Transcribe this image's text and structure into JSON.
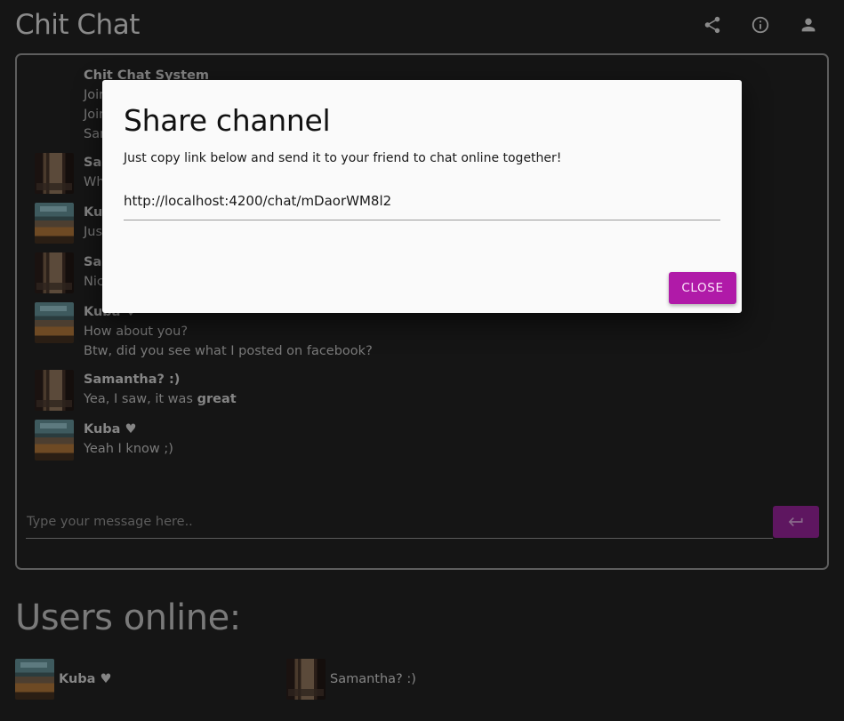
{
  "app": {
    "title": "Chit Chat"
  },
  "toolbar": {
    "icons": [
      "share-icon",
      "info-icon",
      "person-icon"
    ]
  },
  "chat": {
    "groups": [
      {
        "author": "Chit Chat System",
        "avatar": "none",
        "lines": [
          "Joined the channel",
          "Joined the channel",
          "Samantha? :) joined the channel"
        ]
      },
      {
        "author": "Samantha? :)",
        "avatar": "sam",
        "lines": [
          "What's up?"
        ]
      },
      {
        "author": "Kuba ♥",
        "avatar": "kuba",
        "lines": [
          "Just fine"
        ]
      },
      {
        "author": "Samantha? :)",
        "avatar": "sam",
        "lines": [
          "Nice"
        ]
      },
      {
        "author": "Kuba ♥",
        "avatar": "kuba",
        "lines": [
          "How about you?",
          "Btw, did you see what I posted on facebook?"
        ]
      },
      {
        "author": "Samantha? :)",
        "avatar": "sam",
        "lines": [
          "Yea, I saw, it was "
        ],
        "bold_suffix": "great"
      },
      {
        "author": "Kuba ♥",
        "avatar": "kuba",
        "lines": [
          "Yeah I know ;)"
        ]
      }
    ],
    "input": {
      "placeholder": "Type your message here..",
      "value": ""
    },
    "send_icon": "return-arrow-icon"
  },
  "users": {
    "title": "Users online:",
    "list": [
      {
        "name": "Kuba ♥",
        "avatar": "kuba",
        "bold": true
      },
      {
        "name": "Samantha? :)",
        "avatar": "sam",
        "bold": false
      }
    ]
  },
  "dialog": {
    "title": "Share channel",
    "description": "Just copy link below and send it to your friend to chat online together!",
    "link": "http://localhost:4200/chat/mDaorWM8l2",
    "close_label": "CLOSE",
    "close_color": "#b01aa8"
  }
}
